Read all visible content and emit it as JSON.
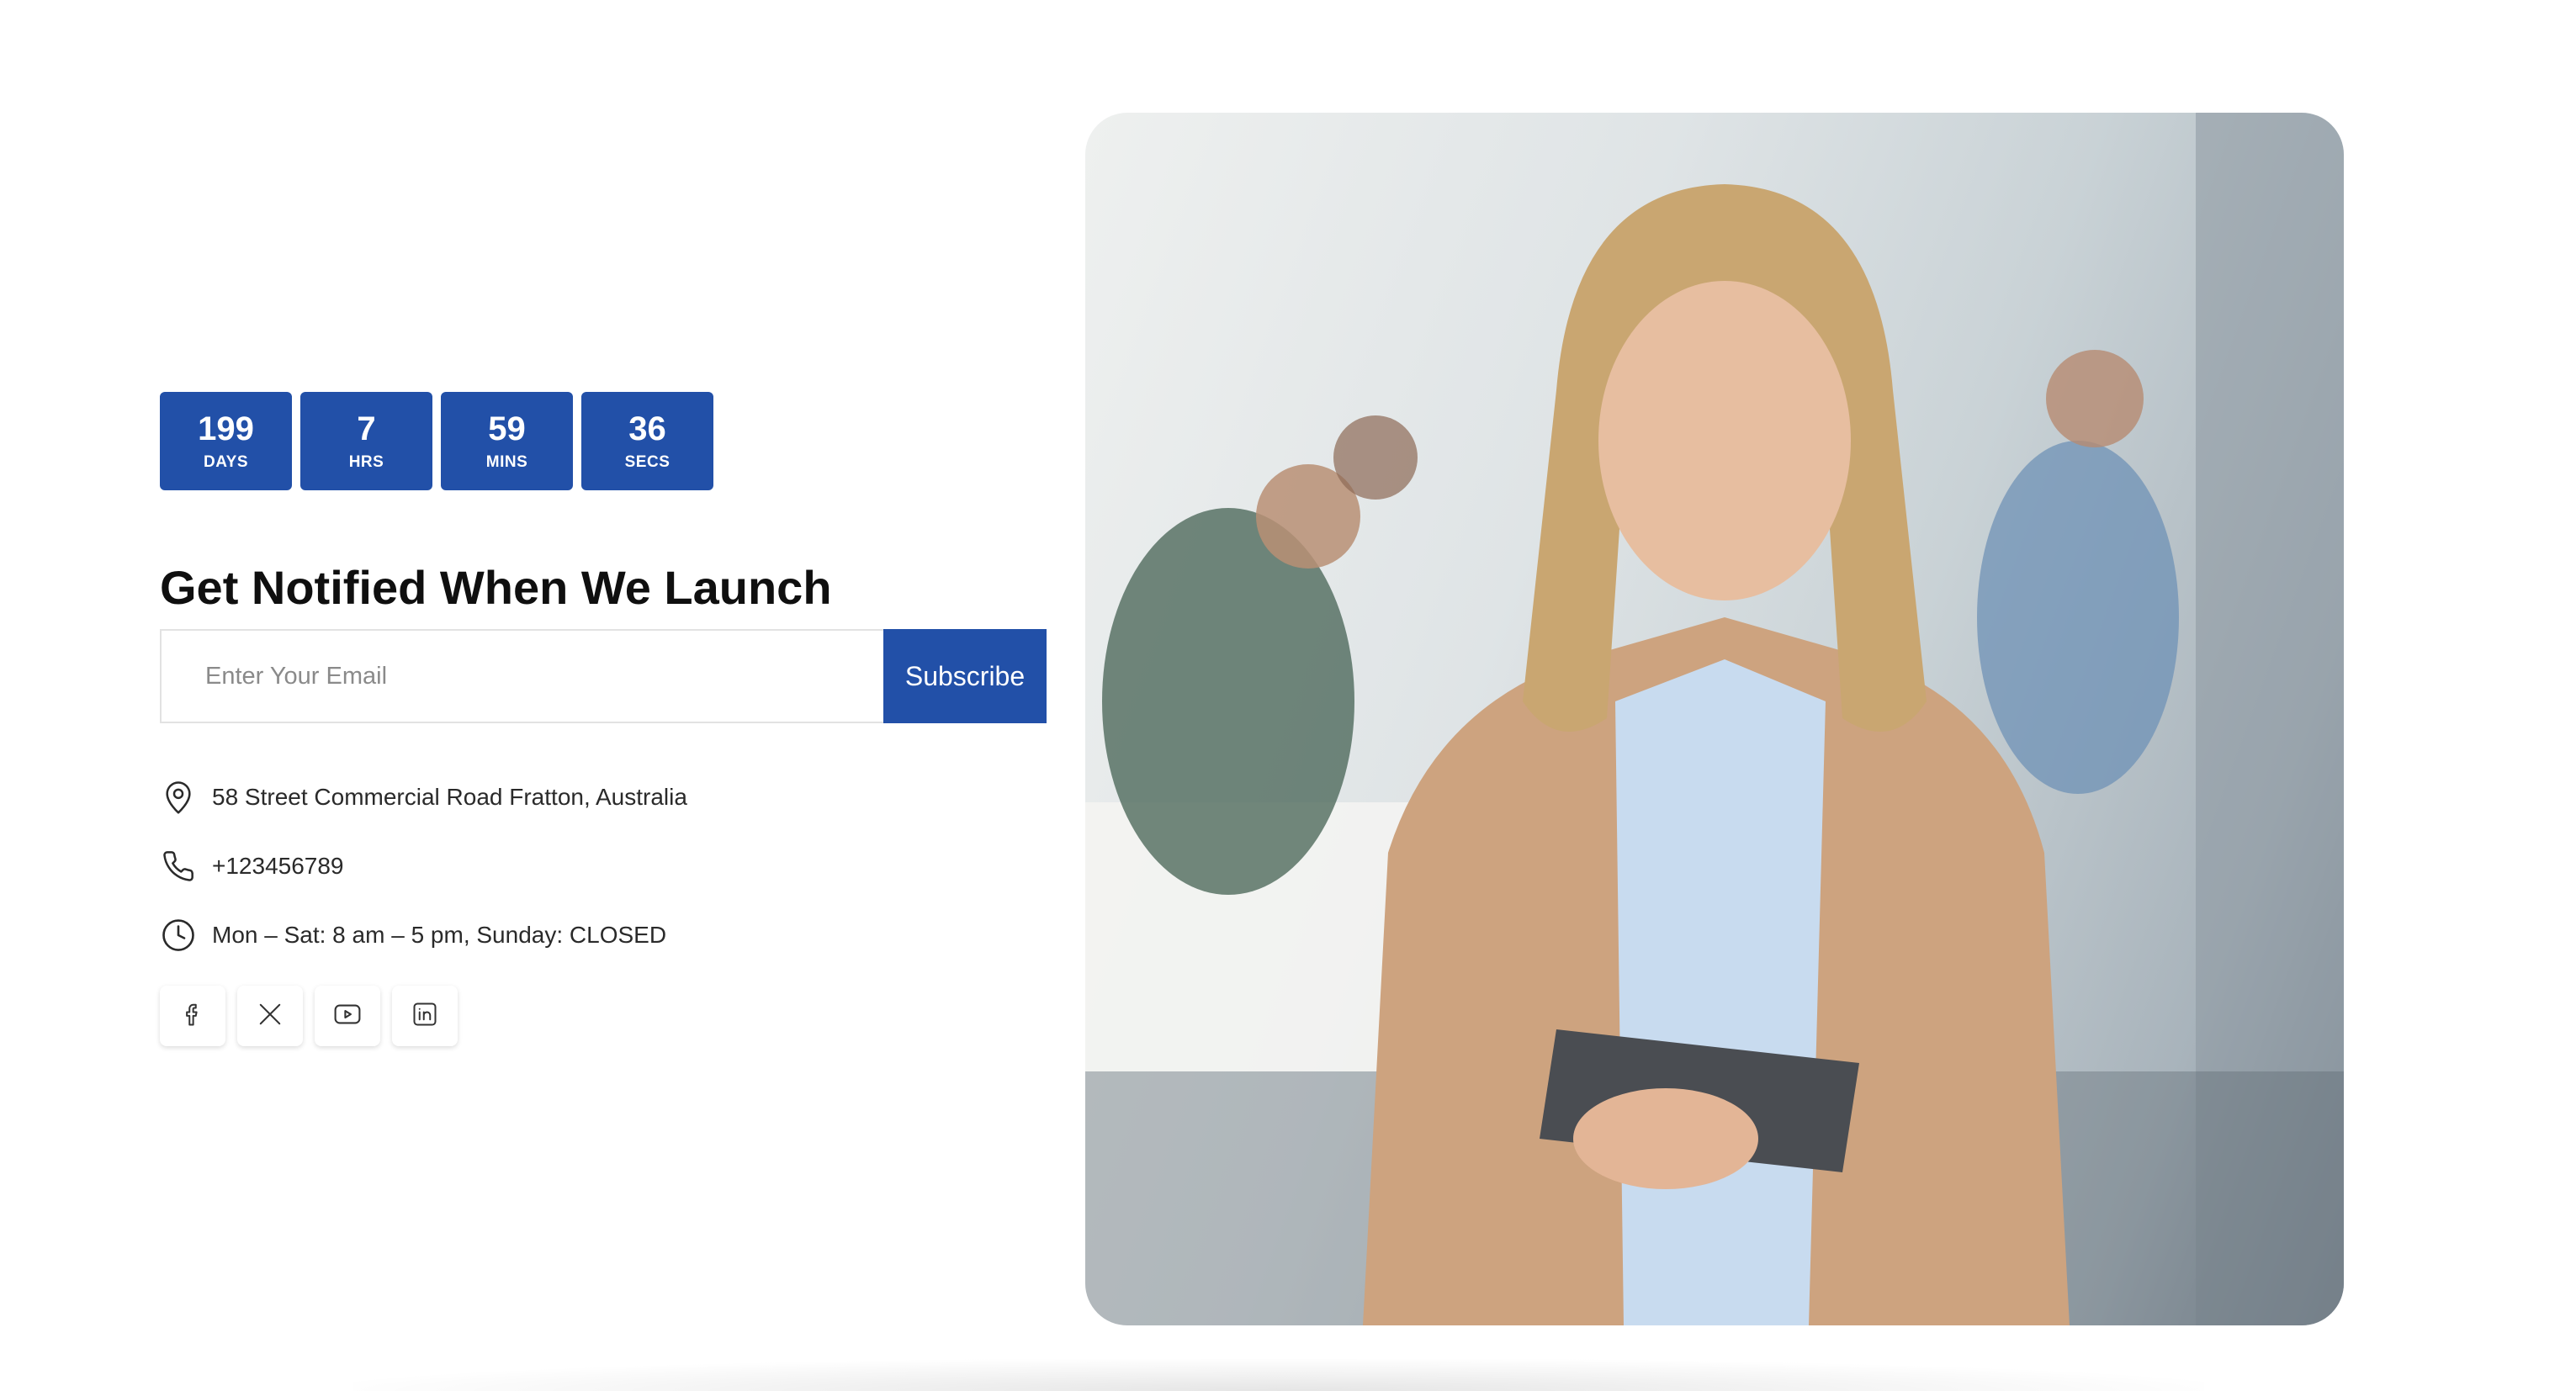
{
  "countdown": [
    {
      "value": "199",
      "label": "DAYS"
    },
    {
      "value": "7",
      "label": "HRS"
    },
    {
      "value": "59",
      "label": "MINS"
    },
    {
      "value": "36",
      "label": "SECS"
    }
  ],
  "heading": "Get Notified When We Launch",
  "form": {
    "email_placeholder": "Enter Your Email",
    "email_value": "",
    "subscribe_label": "Subscribe"
  },
  "contact": {
    "address": "58 Street Commercial Road Fratton, Australia",
    "phone": "+123456789",
    "hours": "Mon – Sat: 8 am – 5 pm, Sunday: CLOSED"
  },
  "socials": [
    {
      "icon": "facebook-icon"
    },
    {
      "icon": "x-icon"
    },
    {
      "icon": "youtube-icon"
    },
    {
      "icon": "linkedin-icon"
    }
  ],
  "colors": {
    "accent": "#2250a8",
    "heading": "#0f0f0f",
    "text": "#2a2a2a"
  }
}
